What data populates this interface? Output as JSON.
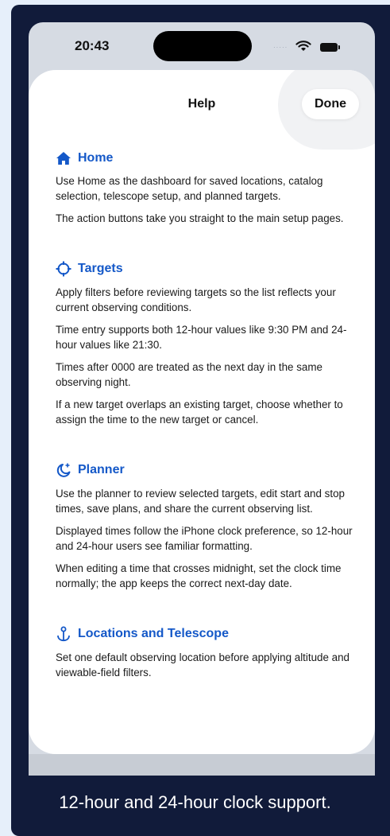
{
  "status": {
    "time": "20:43"
  },
  "header": {
    "title": "Help",
    "done_label": "Done"
  },
  "sections": [
    {
      "title": "Home",
      "icon": "house-icon",
      "paragraphs": [
        "Use Home as the dashboard for saved locations, catalog selection, telescope setup, and planned targets.",
        "The action buttons take you straight to the main setup pages."
      ]
    },
    {
      "title": "Targets",
      "icon": "scope-icon",
      "paragraphs": [
        "Apply filters before reviewing targets so the list reflects your current observing conditions.",
        "Time entry supports both 12-hour values like 9:30 PM and 24-hour values like 21:30.",
        "Times after 0000 are treated as the next day in the same observing night.",
        "If a new target overlaps an existing target, choose whether to assign the time to the new target or cancel."
      ]
    },
    {
      "title": "Planner",
      "icon": "moon-stars-icon",
      "paragraphs": [
        "Use the planner to review selected targets, edit start and stop times, save plans, and share the current observing list.",
        "Displayed times follow the iPhone clock preference, so 12-hour and 24-hour users see familiar formatting.",
        "When editing a time that crosses midnight, set the clock time normally; the app keeps the correct next-day date."
      ]
    },
    {
      "title": "Locations and Telescope",
      "icon": "anchor-pin-icon",
      "paragraphs": [
        "Set one default observing location before applying altitude and viewable-field filters."
      ]
    }
  ],
  "caption": "12-hour and 24-hour clock support.",
  "colors": {
    "accent": "#1458c8",
    "frame": "#111b3a",
    "background": "#e6effa"
  }
}
